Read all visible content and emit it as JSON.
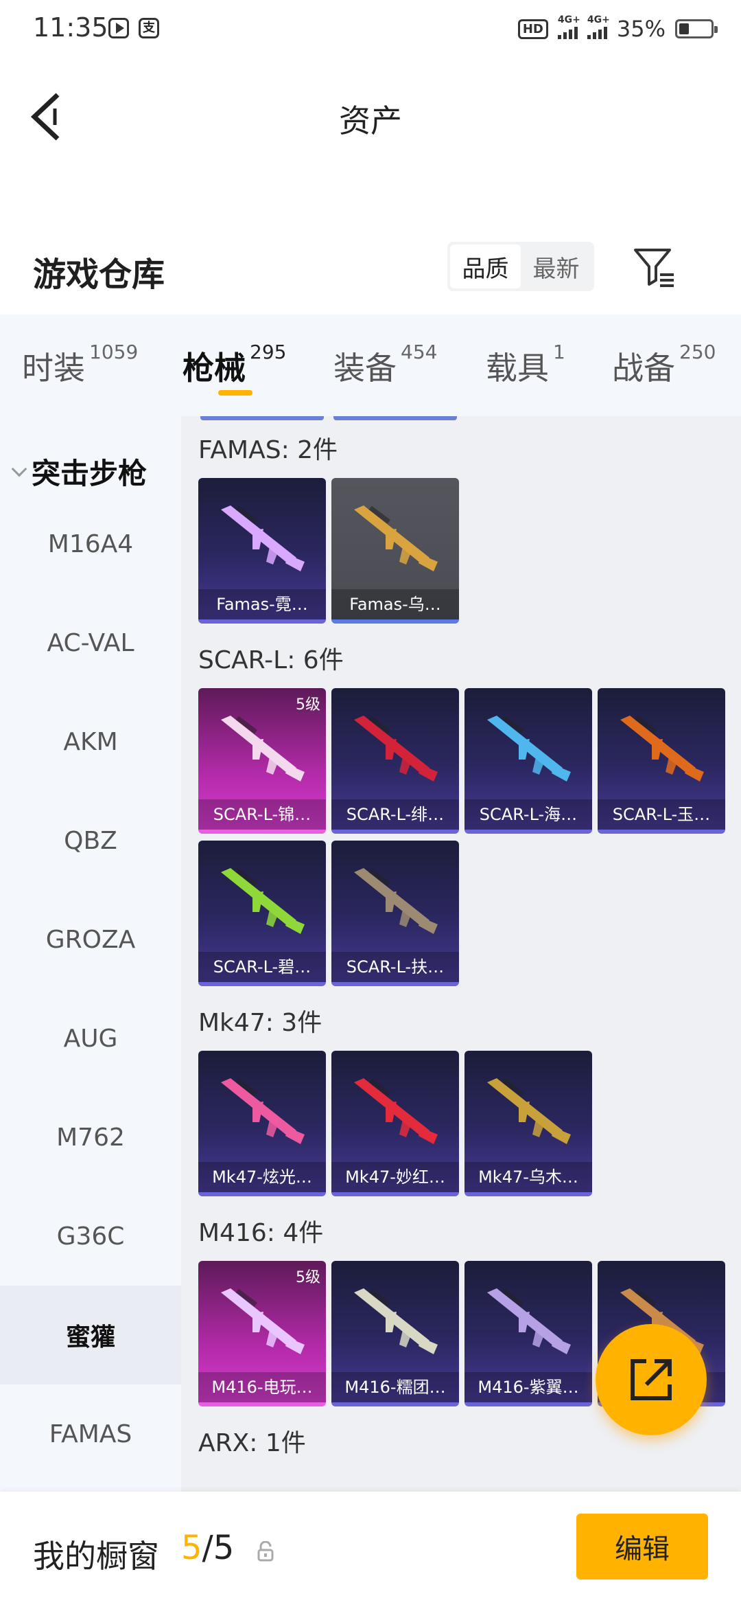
{
  "status": {
    "time": "11:35",
    "battery": "35%",
    "network1": "4G+",
    "network2": "4G+",
    "hd": "HD"
  },
  "nav": {
    "title": "资产"
  },
  "warehouse": {
    "title": "游戏仓库",
    "sort_options": [
      "品质",
      "最新"
    ]
  },
  "tabs": [
    {
      "label": "时装",
      "count": "1059"
    },
    {
      "label": "枪械",
      "count": "295"
    },
    {
      "label": "装备",
      "count": "454"
    },
    {
      "label": "载具",
      "count": "1"
    },
    {
      "label": "战备",
      "count": "250"
    }
  ],
  "sidebar": {
    "header": "突击步枪",
    "items": [
      "M16A4",
      "AC-VAL",
      "AKM",
      "QBZ",
      "GROZA",
      "AUG",
      "M762",
      "G36C",
      "蜜獾",
      "FAMAS"
    ],
    "selected": "蜜獾"
  },
  "groups": [
    {
      "title": "FAMAS: 2件",
      "items": [
        {
          "name": "Famas-霓…",
          "style": "purple",
          "color": "#d9a8ff",
          "level": ""
        },
        {
          "name": "Famas-乌…",
          "style": "gray",
          "color": "#d9a440",
          "level": ""
        }
      ]
    },
    {
      "title": "SCAR-L: 6件",
      "items": [
        {
          "name": "SCAR-L-锦…",
          "style": "pink",
          "color": "#f4d8ee",
          "level": "5级"
        },
        {
          "name": "SCAR-L-绯…",
          "style": "purple",
          "color": "#d2233a",
          "level": ""
        },
        {
          "name": "SCAR-L-海…",
          "style": "purple",
          "color": "#4fb6ee",
          "level": ""
        },
        {
          "name": "SCAR-L-玉…",
          "style": "purple",
          "color": "#e06a1c",
          "level": ""
        },
        {
          "name": "SCAR-L-碧…",
          "style": "purple",
          "color": "#8ed83a",
          "level": ""
        },
        {
          "name": "SCAR-L-扶…",
          "style": "purple",
          "color": "#9c8a72",
          "level": ""
        }
      ]
    },
    {
      "title": "Mk47: 3件",
      "items": [
        {
          "name": "Mk47-炫光…",
          "style": "purple",
          "color": "#ee5aa0",
          "level": ""
        },
        {
          "name": "Mk47-妙红…",
          "style": "purple",
          "color": "#e32b3c",
          "level": ""
        },
        {
          "name": "Mk47-乌木…",
          "style": "purple",
          "color": "#c9a13a",
          "level": ""
        }
      ]
    },
    {
      "title": "M416: 4件",
      "items": [
        {
          "name": "M416-电玩…",
          "style": "pink",
          "color": "#e9c6ff",
          "level": "5级"
        },
        {
          "name": "M416-糯团…",
          "style": "purple",
          "color": "#d8d8c4",
          "level": ""
        },
        {
          "name": "M416-紫翼…",
          "style": "purple",
          "color": "#b7a1e6",
          "level": ""
        },
        {
          "name": "",
          "style": "purple",
          "color": "#c98a4a",
          "level": ""
        }
      ]
    },
    {
      "title": "ARX: 1件",
      "items": []
    }
  ],
  "showcase": {
    "label": "我的橱窗",
    "current": "5",
    "separator": "/",
    "total": "5",
    "edit_label": "编辑"
  },
  "colors": {
    "accent": "#ffb300",
    "sidebar_bg": "#f4f8fd",
    "content_bg": "#eef0f4"
  }
}
